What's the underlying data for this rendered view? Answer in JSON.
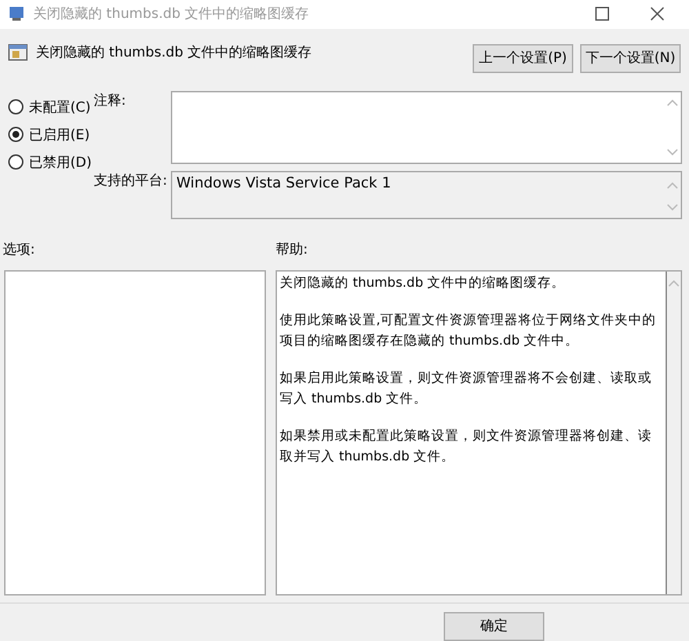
{
  "window": {
    "title": "关闭隐藏的 thumbs.db 文件中的缩略图缓存"
  },
  "header": {
    "title": "关闭隐藏的 thumbs.db 文件中的缩略图缓存",
    "buttons": [
      "上一个设置(P)",
      "下一个设置(N)"
    ]
  },
  "state_options": [
    {
      "label": "未配置(C)",
      "selected": false
    },
    {
      "label": "已启用(E)",
      "selected": true
    },
    {
      "label": "已禁用(D)",
      "selected": false
    }
  ],
  "comment": {
    "label": "注释:"
  },
  "platform": {
    "label": "支持的平台:",
    "value": "Windows Vista Service Pack 1"
  },
  "options": {
    "label": "选项:"
  },
  "help": {
    "label": "帮助:",
    "paragraphs": [
      "关闭隐藏的 thumbs.db 文件中的缩略图缓存。",
      "使用此策略设置,可配置文件资源管理器将位于网络文件夹中的项目的缩略图缓存在隐藏的 thumbs.db 文件中。",
      "如果启用此策略设置，则文件资源管理器将不会创建、读取或写入 thumbs.db 文件。",
      "如果禁用或未配置此策略设置，则文件资源管理器将创建、读取并写入 thumbs.db 文件。"
    ]
  },
  "footer_buttons": [
    "确定"
  ]
}
